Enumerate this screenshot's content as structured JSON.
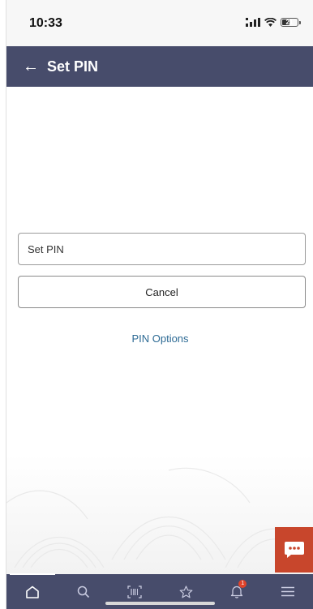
{
  "status_bar": {
    "time": "10:33",
    "battery_level": "21"
  },
  "header": {
    "back_icon": "arrow-left-icon",
    "title": "Set PIN"
  },
  "form": {
    "pin_placeholder": "Set PIN",
    "pin_value": "",
    "cancel_label": "Cancel",
    "pin_options_label": "PIN Options"
  },
  "chat": {
    "icon": "chat-bubble-icon"
  },
  "bottom_nav": {
    "items": [
      {
        "icon": "home-icon",
        "active": true
      },
      {
        "icon": "search-icon",
        "active": false
      },
      {
        "icon": "barcode-scan-icon",
        "active": false
      },
      {
        "icon": "star-icon",
        "active": false
      },
      {
        "icon": "bell-icon",
        "active": false,
        "badge": "1"
      },
      {
        "icon": "menu-icon",
        "active": false
      }
    ]
  },
  "colors": {
    "header_bg": "#474c6b",
    "link": "#2c6a94",
    "chat_bg": "#c8462c",
    "badge": "#e0432a"
  }
}
